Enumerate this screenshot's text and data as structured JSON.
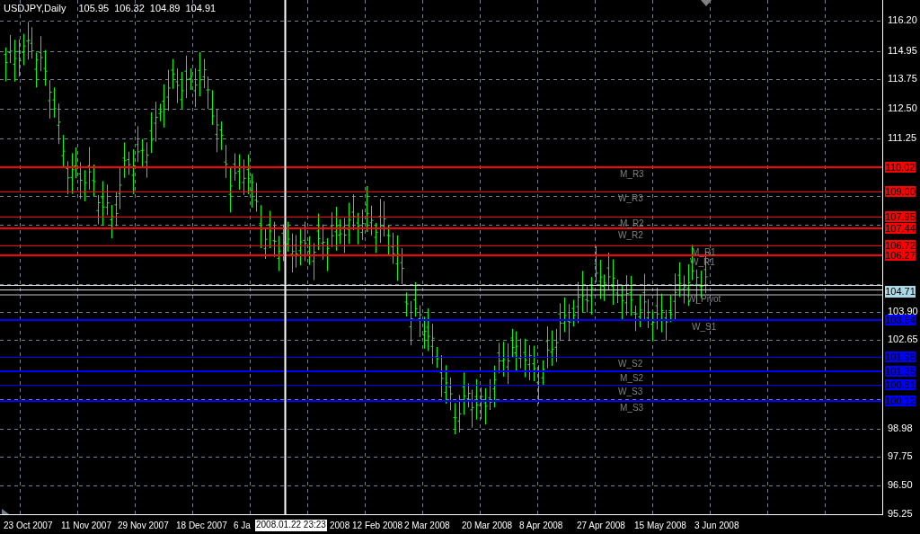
{
  "header": {
    "symbol": "USDJPY,Daily",
    "ohlc": [
      "105.95",
      "106.32",
      "104.89",
      "104.91"
    ]
  },
  "price_axis": {
    "ticks": [
      "116.20",
      "114.95",
      "113.75",
      "112.50",
      "111.25",
      "103.90",
      "102.65",
      "98.98",
      "97.75",
      "96.50",
      "95.25"
    ]
  },
  "levels": [
    {
      "name": "M_R3",
      "price": "110.02",
      "color": "#ff0000",
      "kind": "thick"
    },
    {
      "name": "W_R3",
      "price": "109.00",
      "color": "#ff0000",
      "kind": "thin"
    },
    {
      "name": "M_R2",
      "price": "107.95",
      "color": "#ff0000",
      "kind": "thin"
    },
    {
      "name": "W_R2",
      "price": "107.44",
      "color": "#ff0000",
      "kind": "thick"
    },
    {
      "name": "M_R1",
      "price": "106.72",
      "color": "#ff0000",
      "kind": "thin"
    },
    {
      "name": "W_R1",
      "price": "106.27",
      "color": "#ff0000",
      "kind": "thick"
    },
    {
      "kind": "pivot"
    },
    {
      "name": "W_Pivot",
      "kind": "pivot"
    },
    {
      "name": "W_S1",
      "price": "103.54",
      "color": "#0000ff",
      "kind": "thick"
    },
    {
      "name": "W_S2",
      "price": "101.98",
      "color": "#0000ff",
      "kind": "thin"
    },
    {
      "name": "M_S2",
      "price": "101.35",
      "color": "#0000ff",
      "kind": "thick"
    },
    {
      "name": "W_S3",
      "price": "100.81",
      "color": "#0000ff",
      "kind": "thin"
    },
    {
      "name": "M_S3",
      "price": "100.12",
      "color": "#0000ff",
      "kind": "thick"
    }
  ],
  "bid": {
    "price": "104.71"
  },
  "time_axis": {
    "labels": [
      "23 Oct 2007",
      "11 Nov 2007",
      "29 Nov 2007",
      "18 Dec 2007",
      "6 Ja",
      "2008",
      "12 Feb 2008",
      "2 Mar 2008",
      "20 Mar 2008",
      "8 Apr 2008",
      "27 Apr 2008",
      "15 May 2008",
      "3 Jun 2008"
    ]
  },
  "crosshair": {
    "time": "2008.01.22 23:23"
  }
}
